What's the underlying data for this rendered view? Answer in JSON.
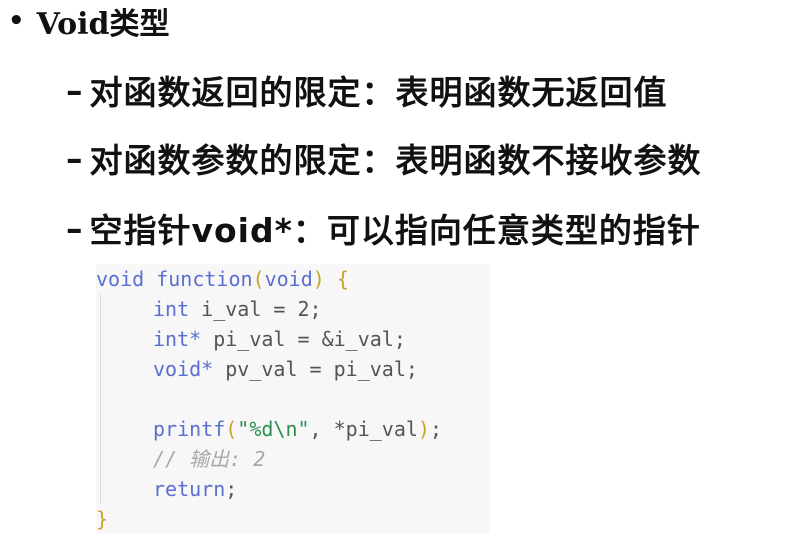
{
  "slide": {
    "title": "Void类型",
    "bullet": "•",
    "dash": "–",
    "items": [
      "对函数返回的限定：表明函数无返回值",
      "对函数参数的限定：表明函数不接收参数",
      "空指针void*：可以指向任意类型的指针"
    ]
  },
  "code": {
    "line1": {
      "kw": "void",
      "fn": "function",
      "lparen": "(",
      "param": "void",
      "rparen": ")",
      "brace": "{"
    },
    "line2": {
      "kw": "int",
      "rest": " i_val = 2;"
    },
    "line3": {
      "kw": "int*",
      "rest": " pi_val = &i_val;"
    },
    "line4": {
      "kw": "void*",
      "rest": " pv_val = pi_val;"
    },
    "line6": {
      "fn": "printf",
      "lparen": "(",
      "str": "\"%d\\n\"",
      "rest": ", *pi_val",
      "rparen": ")",
      "semi": ";"
    },
    "line7": {
      "comment": "// 输出: 2"
    },
    "line8": {
      "kw": "return",
      "semi": ";"
    },
    "line9": {
      "brace": "}"
    }
  }
}
